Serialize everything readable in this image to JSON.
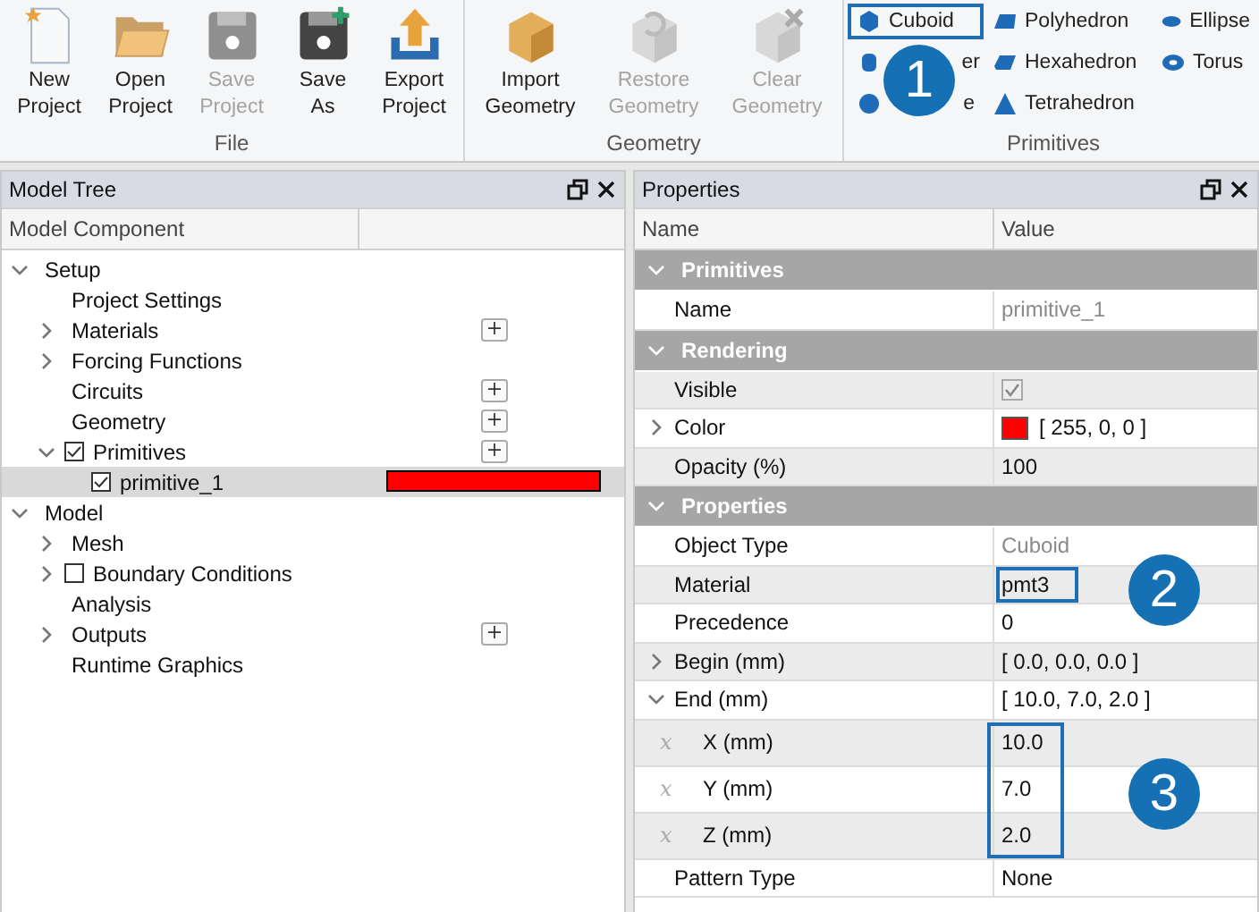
{
  "ribbon": {
    "groups": [
      {
        "title": "File",
        "buttons": [
          {
            "kind": "new",
            "label": "New Project",
            "disabled": false
          },
          {
            "kind": "open",
            "label": "Open Project",
            "disabled": false
          },
          {
            "kind": "save",
            "label": "Save Project",
            "disabled": true
          },
          {
            "kind": "saveas",
            "label": "Save As",
            "disabled": false
          },
          {
            "kind": "export",
            "label": "Export Project",
            "disabled": false
          }
        ]
      },
      {
        "title": "Geometry",
        "buttons": [
          {
            "kind": "import",
            "label": "Import Geometry",
            "disabled": false
          },
          {
            "kind": "restore",
            "label": "Restore Geometry",
            "disabled": true
          },
          {
            "kind": "clear",
            "label": "Clear Geometry",
            "disabled": true
          }
        ]
      }
    ],
    "primitives": {
      "title": "Primitives",
      "items": [
        {
          "kind": "cuboid",
          "label": "Cuboid",
          "highlighted": true
        },
        {
          "kind": "cylinder",
          "label": "er",
          "covered": true
        },
        {
          "kind": "sphere",
          "label": "e",
          "covered": true
        },
        {
          "kind": "polyhedron",
          "label": "Polyhedron"
        },
        {
          "kind": "hexahedron",
          "label": "Hexahedron"
        },
        {
          "kind": "tetrahedron",
          "label": "Tetrahedron"
        },
        {
          "kind": "ellipse",
          "label": "Ellipse"
        },
        {
          "kind": "torus",
          "label": "Torus"
        }
      ]
    }
  },
  "model_tree": {
    "title": "Model Tree",
    "columns": [
      "Model Component"
    ],
    "items": [
      {
        "label": "Setup",
        "expanded": true,
        "selected": false,
        "children": [
          {
            "label": "Project Settings",
            "selected": false
          },
          {
            "label": "Materials",
            "expanded": false,
            "add_button": true,
            "selected": false
          },
          {
            "label": "Forcing Functions",
            "expanded": false,
            "selected": false
          },
          {
            "label": "Circuits",
            "add_button": true,
            "selected": false
          },
          {
            "label": "Geometry",
            "add_button": true,
            "selected": false
          },
          {
            "label": "Primitives",
            "expanded": true,
            "checked": true,
            "add_button": true,
            "selected": false,
            "children": [
              {
                "label": "primitive_1",
                "checked": true,
                "color": "#ff0000",
                "selected": true
              }
            ]
          }
        ]
      },
      {
        "label": "Model",
        "expanded": true,
        "selected": false,
        "children": [
          {
            "label": "Mesh",
            "expanded": false,
            "selected": false
          },
          {
            "label": "Boundary Conditions",
            "expanded": false,
            "checked": false,
            "selected": false
          },
          {
            "label": "Analysis",
            "selected": false
          },
          {
            "label": "Outputs",
            "expanded": false,
            "add_button": true,
            "selected": false
          },
          {
            "label": "Runtime Graphics",
            "selected": false
          }
        ]
      }
    ]
  },
  "properties": {
    "title": "Properties",
    "columns": [
      "Name",
      "Value"
    ],
    "sections": [
      {
        "title": "Primitives",
        "expanded": true,
        "rows": [
          {
            "name": "Name",
            "value": "primitive_1",
            "readonly": true
          }
        ]
      },
      {
        "title": "Rendering",
        "expanded": true,
        "rows": [
          {
            "name": "Visible",
            "kind": "checkbox",
            "checked": true
          },
          {
            "name": "Color",
            "value": "[ 255, 0, 0 ]",
            "color": "#ff0000",
            "expanded": false
          },
          {
            "name": "Opacity (%)",
            "value": "100"
          }
        ]
      },
      {
        "title": "Properties",
        "expanded": true,
        "rows": [
          {
            "name": "Object Type",
            "value": "Cuboid",
            "readonly": true
          },
          {
            "name": "Material",
            "value": "pmt3",
            "highlighted": true
          },
          {
            "name": "Precedence",
            "value": "0"
          },
          {
            "name": "Begin (mm)",
            "value": "[ 0.0, 0.0, 0.0 ]",
            "expanded": false
          },
          {
            "name": "End (mm)",
            "value": "[ 10.0, 7.0, 2.0 ]",
            "expanded": true,
            "children_highlighted": true,
            "children": [
              {
                "symbol": "𝑥",
                "name": "X (mm)",
                "value": "10.0"
              },
              {
                "symbol": "𝑥",
                "name": "Y (mm)",
                "value": "7.0"
              },
              {
                "symbol": "𝑥",
                "name": "Z (mm)",
                "value": "2.0"
              }
            ]
          },
          {
            "name": "Pattern Type",
            "value": "None"
          }
        ]
      }
    ]
  },
  "callouts": [
    {
      "label": "1"
    },
    {
      "label": "2"
    },
    {
      "label": "3"
    }
  ]
}
